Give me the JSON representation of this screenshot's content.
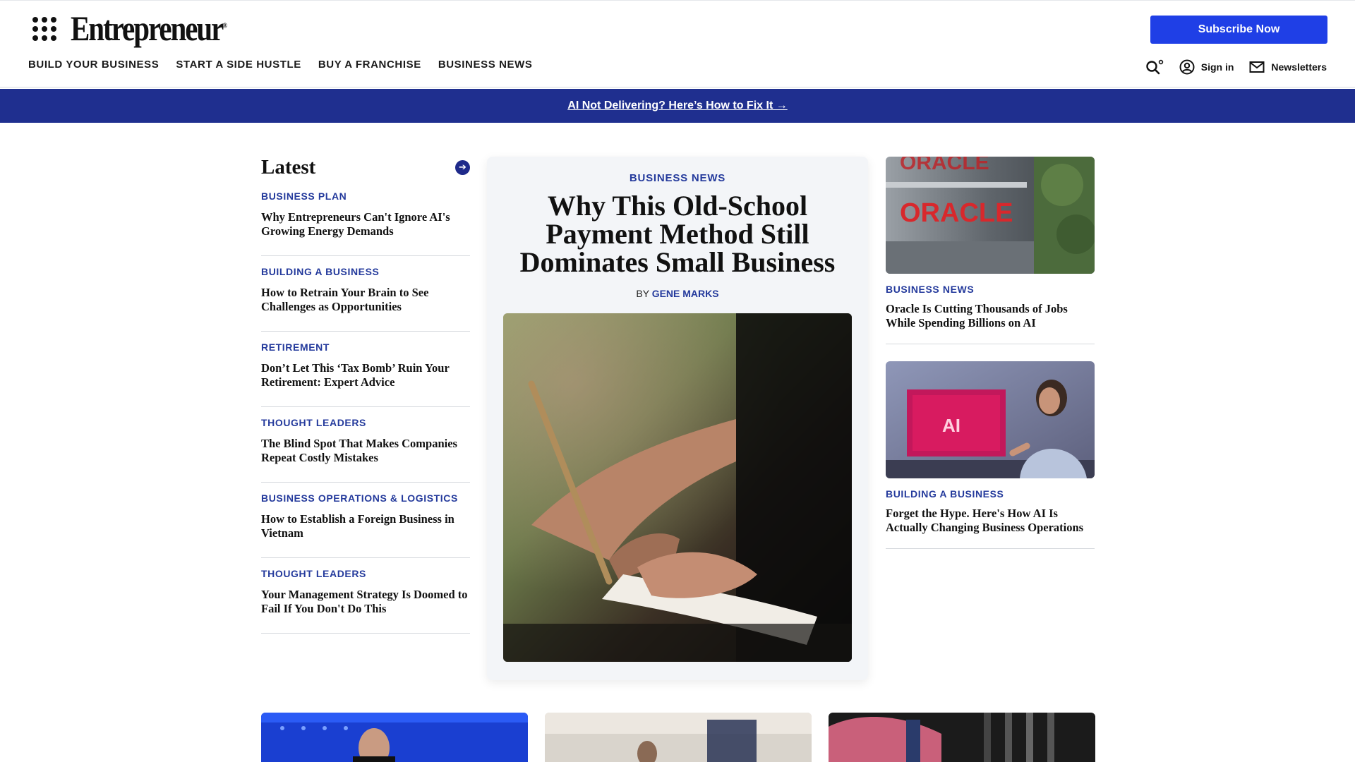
{
  "header": {
    "logo": "Entrepreneur",
    "logo_mark": "®",
    "subscribe_label": "Subscribe Now",
    "nav": [
      "BUILD YOUR BUSINESS",
      "START A SIDE HUSTLE",
      "BUY A FRANCHISE",
      "BUSINESS NEWS"
    ],
    "sign_in_label": "Sign in",
    "newsletters_label": "Newsletters"
  },
  "promo": {
    "text": "AI Not Delivering? Here’s How to Fix It →"
  },
  "latest": {
    "title": "Latest",
    "items": [
      {
        "category": "BUSINESS PLAN",
        "headline": "Why Entrepreneurs Can't Ignore AI's Growing Energy Demands"
      },
      {
        "category": "BUILDING A BUSINESS",
        "headline": "How to Retrain Your Brain to See Challenges as Opportunities"
      },
      {
        "category": "RETIREMENT",
        "headline": "Don’t Let This ‘Tax Bomb’ Ruin Your Retirement: Expert Advice"
      },
      {
        "category": "THOUGHT LEADERS",
        "headline": "The Blind Spot That Makes Companies Repeat Costly Mistakes"
      },
      {
        "category": "BUSINESS OPERATIONS & LOGISTICS",
        "headline": "How to Establish a Foreign Business in Vietnam"
      },
      {
        "category": "THOUGHT LEADERS",
        "headline": "Your Management Strategy Is Doomed to Fail If You Don't Do This"
      }
    ]
  },
  "feature": {
    "category": "BUSINESS NEWS",
    "headline": "Why This Old-School Payment Method Still Dominates Small Business",
    "by": "BY",
    "author": "GENE MARKS"
  },
  "right": [
    {
      "category": "BUSINESS NEWS",
      "headline": "Oracle Is Cutting Thousands of Jobs While Spending Billions on AI",
      "sign_text": "ORACLE"
    },
    {
      "category": "BUILDING A BUSINESS",
      "headline": "Forget the Hype. Here's How AI Is Actually Changing Business Operations",
      "screen_text": "AI"
    }
  ],
  "colors": {
    "accent_blue": "#1f3fe6",
    "category_blue": "#243a9c",
    "promo_bg": "#1f2f8f"
  }
}
